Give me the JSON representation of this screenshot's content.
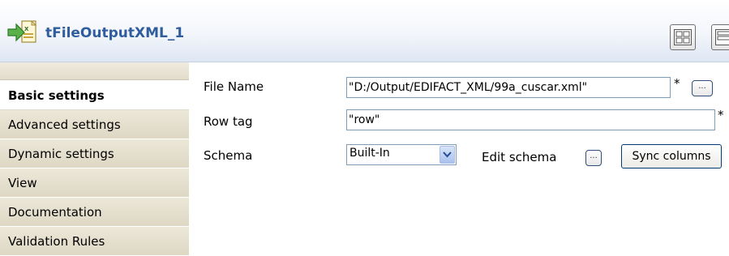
{
  "component": {
    "title": "tFileOutputXML_1",
    "icon": "file-output-xml-icon"
  },
  "header_buttons": [
    {
      "icon": "layout-grid-icon"
    },
    {
      "icon": "layout-list-icon"
    }
  ],
  "sidebar": {
    "items": [
      {
        "label": "Basic settings",
        "active": true
      },
      {
        "label": "Advanced settings"
      },
      {
        "label": "Dynamic settings"
      },
      {
        "label": "View"
      },
      {
        "label": "Documentation"
      },
      {
        "label": "Validation Rules"
      }
    ]
  },
  "form": {
    "file_name": {
      "label": "File Name",
      "value": "\"D:/Output/EDIFACT_XML/99a_cuscar.xml\"",
      "required": "*",
      "browse_label": "..."
    },
    "row_tag": {
      "label": "Row tag",
      "value": "\"row\"",
      "required": "*"
    },
    "schema": {
      "label": "Schema",
      "selected": "Built-In",
      "edit_label": "Edit schema",
      "edit_button_label": "...",
      "sync_label": "Sync columns"
    }
  },
  "colors": {
    "title": "#2f5d9e",
    "sidebar": "#e2dccb",
    "input_border": "#7f9db9"
  }
}
